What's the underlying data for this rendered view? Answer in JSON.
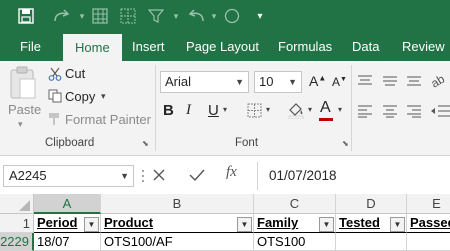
{
  "ribbon_tabs": [
    "File",
    "Home",
    "Insert",
    "Page Layout",
    "Formulas",
    "Data",
    "Review"
  ],
  "clipboard": {
    "paste": "Paste",
    "cut": "Cut",
    "copy": "Copy",
    "format_painter": "Format Painter",
    "group_label": "Clipboard"
  },
  "font": {
    "name": "Arial",
    "size": "10",
    "group_label": "Font"
  },
  "formula_bar": {
    "name_box": "A2245",
    "fx": "fx",
    "value": "01/07/2018"
  },
  "grid": {
    "columns": [
      "A",
      "B",
      "C",
      "D",
      "E"
    ],
    "rows": [
      {
        "num": "1",
        "cells": [
          "Period",
          "Product",
          "Family",
          "Tested",
          "Passed"
        ]
      },
      {
        "num": "2229",
        "cells": [
          "18/07",
          "OTS100/AF",
          "OTS100",
          "",
          ""
        ]
      }
    ]
  },
  "colors": {
    "brand_green": "#217346"
  }
}
